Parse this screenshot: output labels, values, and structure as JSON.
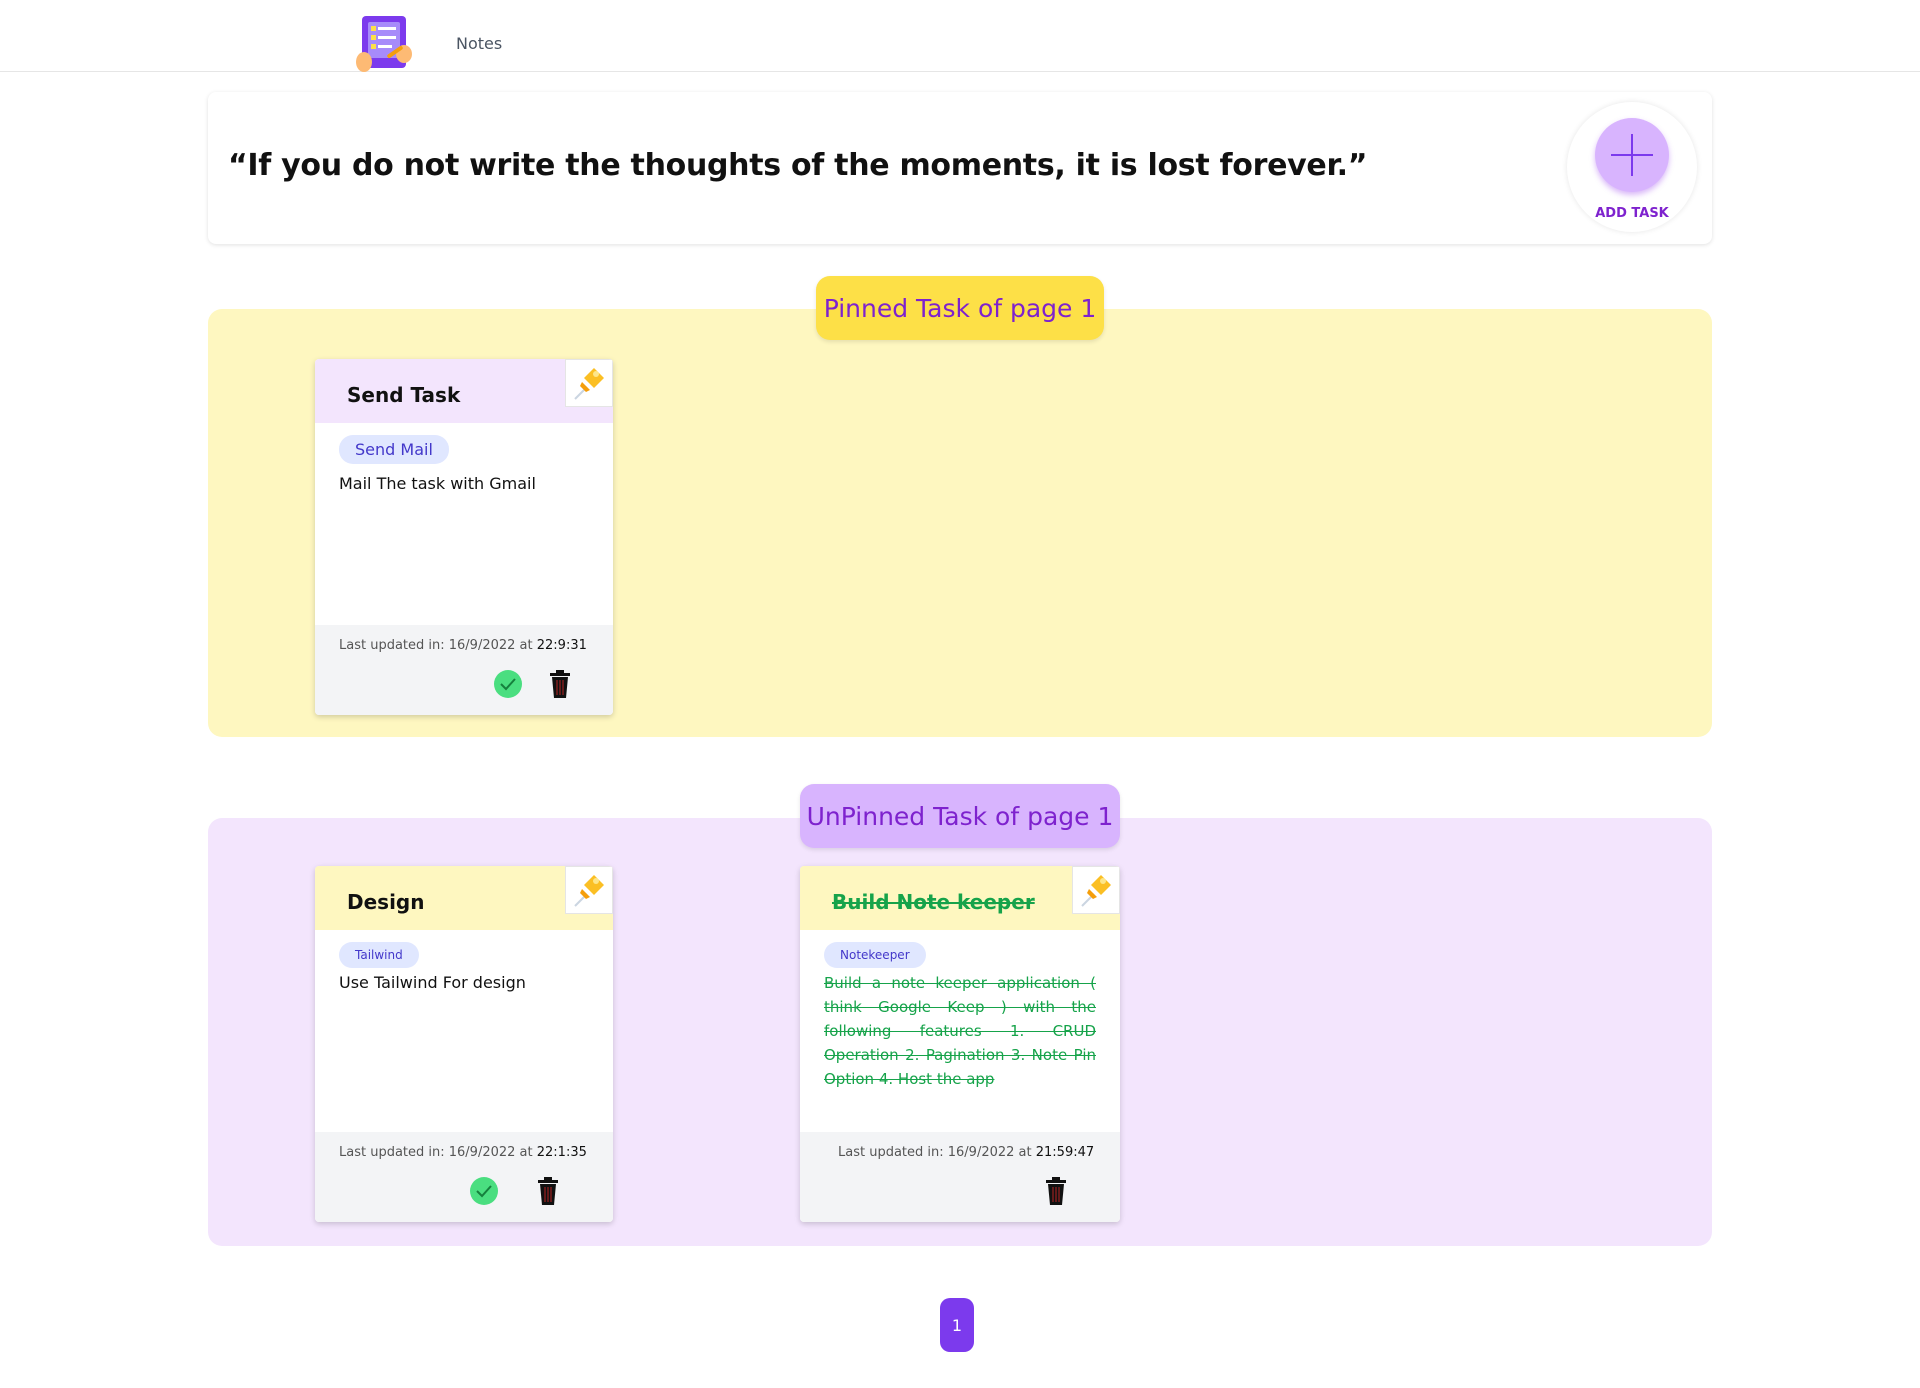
{
  "header": {
    "logo_icon": "notes-app-logo-icon",
    "nav_notes": "Notes"
  },
  "quote": {
    "text": "“If you do not write the thoughts of the moments, it is lost forever.”"
  },
  "add_task": {
    "label": "ADD TASK",
    "icon": "plus-icon"
  },
  "colors": {
    "accent": "#7e22ce",
    "pinned_bg": "#fef7c0",
    "pinned_badge": "#fde047",
    "unpinned_bg": "#f3e5fd",
    "unpinned_badge": "#d8b4fe",
    "done": "#16a34a",
    "page_button": "#7c3aed"
  },
  "pinned": {
    "heading": "Pinned Task of page 1",
    "cards": [
      {
        "title": "Send Task",
        "tag": "Send Mail",
        "body": "Mail The task with Gmail",
        "updated_label": "Last updated in: 16/9/2022 at ",
        "updated_time": "22:9:31",
        "completed": false
      }
    ]
  },
  "unpinned": {
    "heading": "UnPinned Task of page 1",
    "cards": [
      {
        "title": "Design",
        "tag": "Tailwind",
        "body": "Use Tailwind For design",
        "updated_label": "Last updated in: 16/9/2022 at ",
        "updated_time": "22:1:35",
        "completed": false
      },
      {
        "title": "Build Note  keeper",
        "tag": "Notekeeper",
        "body": "Build a note keeper application ( think Google Keep ) with the following features 1. CRUD Operation 2. Pagination 3. Note Pin Option 4. Host the app",
        "updated_label": "Last updated in: 16/9/2022 at ",
        "updated_time": "21:59:47",
        "completed": true
      }
    ]
  },
  "pagination": {
    "current_page": "1"
  }
}
